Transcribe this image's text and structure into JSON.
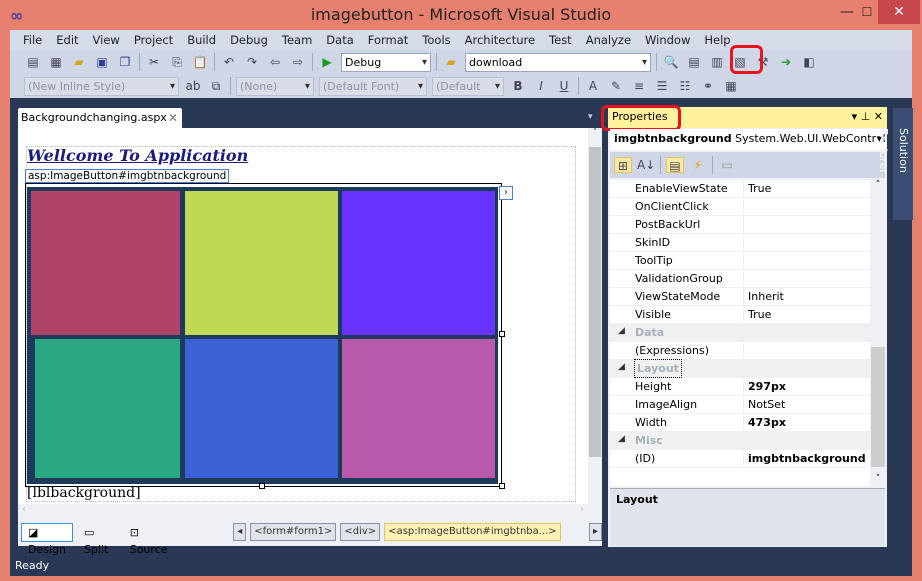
{
  "window": {
    "title": "imagebutton - Microsoft Visual Studio",
    "minimize": "—",
    "maximize": "☐",
    "close": "✕"
  },
  "menu": [
    "File",
    "Edit",
    "View",
    "Project",
    "Build",
    "Debug",
    "Team",
    "Data",
    "Format",
    "Tools",
    "Architecture",
    "Test",
    "Analyze",
    "Window",
    "Help"
  ],
  "toolbar": {
    "config": "Debug",
    "find": "download",
    "style": "(New Inline Style)",
    "target": "(None)",
    "font": "(Default Font)",
    "size": "(Default"
  },
  "document": {
    "tab": "Backgroundchanging.aspx",
    "heading": "Wellcome To Application",
    "control_tag": "asp:ImageButton#imgbtnbackground",
    "label": "[lblbackground]",
    "tile_colors": [
      "#b04468",
      "#bfd855",
      "#6633ff",
      "#2aa884",
      "#3a62d6",
      "#b85aab"
    ]
  },
  "viewbar": {
    "design": "Design",
    "split": "Split",
    "source": "Source",
    "crumbs": [
      "<form#form1>",
      "<div>",
      "<asp:ImageButton#imgbtnba...>"
    ]
  },
  "properties": {
    "title": "Properties",
    "object": "imgbtnbackground",
    "type": "System.Web.UI.WebControls.",
    "rows": [
      {
        "name": "EnableViewState",
        "value": "True"
      },
      {
        "name": "OnClientClick",
        "value": ""
      },
      {
        "name": "PostBackUrl",
        "value": ""
      },
      {
        "name": "SkinID",
        "value": ""
      },
      {
        "name": "ToolTip",
        "value": ""
      },
      {
        "name": "ValidationGroup",
        "value": ""
      },
      {
        "name": "ViewStateMode",
        "value": "Inherit"
      },
      {
        "name": "Visible",
        "value": "True"
      },
      {
        "name": "Data",
        "category": true
      },
      {
        "name": "(Expressions)",
        "value": ""
      },
      {
        "name": "Layout",
        "category": true
      },
      {
        "name": "Height",
        "value": "297px",
        "bold": true
      },
      {
        "name": "ImageAlign",
        "value": "NotSet"
      },
      {
        "name": "Width",
        "value": "473px",
        "bold": true
      },
      {
        "name": "Misc",
        "category": true
      },
      {
        "name": "(ID)",
        "value": "imgbtnbackground",
        "bold": true
      }
    ],
    "description": "Layout"
  },
  "solution_explorer": "Solution Explorer",
  "status": "Ready"
}
